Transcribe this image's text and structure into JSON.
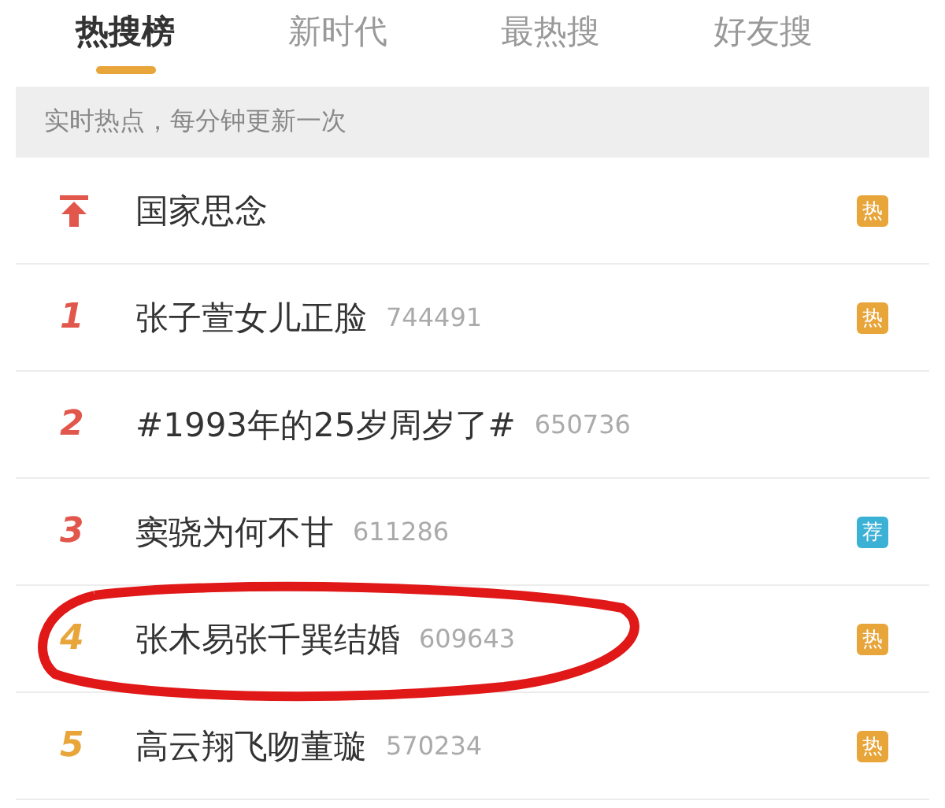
{
  "tabs": [
    {
      "label": "热搜榜",
      "selected": true
    },
    {
      "label": "新时代",
      "selected": false
    },
    {
      "label": "最热搜",
      "selected": false
    },
    {
      "label": "好友搜",
      "selected": false
    }
  ],
  "notice": "实时热点，每分钟更新一次",
  "rows": [
    {
      "kind": "pinned",
      "title": "国家思念",
      "color": "#e2574c",
      "badge": {
        "text": "热",
        "color": "#e8a53a"
      },
      "circled": false
    },
    {
      "kind": "ranked",
      "rank": "1",
      "title": "张子萱女儿正脸",
      "count": "744491",
      "color": "#e2574c",
      "badge": {
        "text": "热",
        "color": "#e8a53a"
      },
      "circled": false
    },
    {
      "kind": "ranked",
      "rank": "2",
      "title": "#1993年的25岁周岁了#",
      "count": "650736",
      "color": "#e2574c",
      "circled": false
    },
    {
      "kind": "ranked",
      "rank": "3",
      "title": "窦骁为何不甘",
      "count": "611286",
      "color": "#e2574c",
      "badge": {
        "text": "荐",
        "color": "#3bb1d6"
      },
      "circled": false
    },
    {
      "kind": "ranked",
      "rank": "4",
      "title": "张木易张千巽结婚",
      "count": "609643",
      "color": "#e8a53a",
      "badge": {
        "text": "热",
        "color": "#e8a53a"
      },
      "circled": true
    },
    {
      "kind": "ranked",
      "rank": "5",
      "title": "高云翔飞吻董璇",
      "count": "570234",
      "color": "#e8a53a",
      "badge": {
        "text": "热",
        "color": "#e8a53a"
      },
      "circled": false
    }
  ]
}
